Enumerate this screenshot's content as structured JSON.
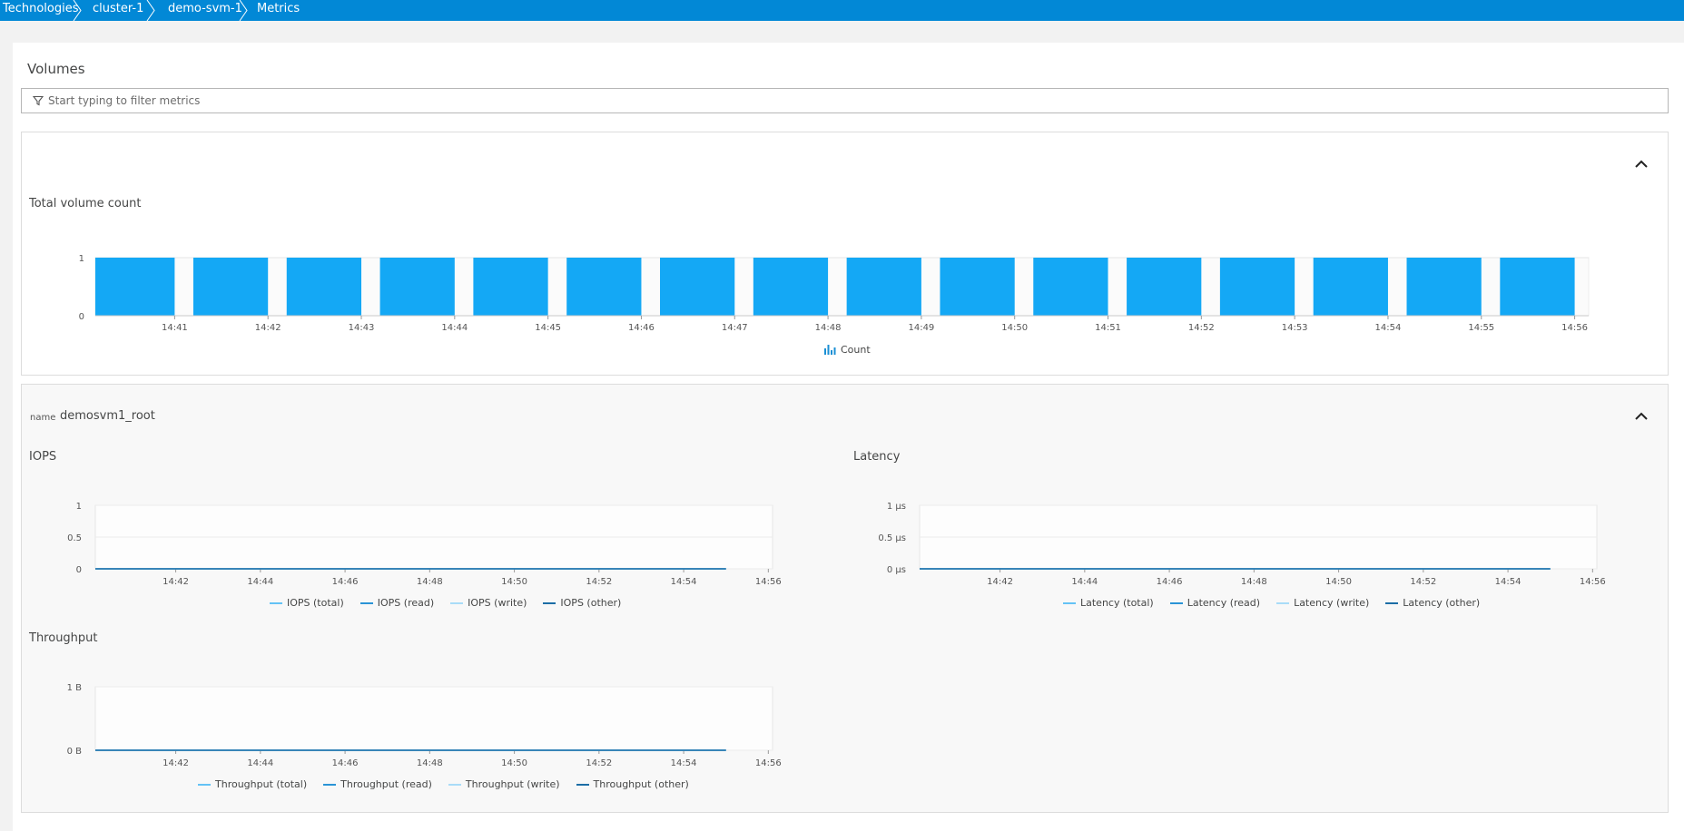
{
  "breadcrumb": [
    {
      "label": "Technologies"
    },
    {
      "label": "cluster-1"
    },
    {
      "label": "demo-svm-1"
    },
    {
      "label": "Metrics"
    }
  ],
  "section_title": "Volumes",
  "filter": {
    "placeholder": "Start typing to filter metrics"
  },
  "colors": {
    "accent": "#0288d6",
    "bar": "#14a8f5"
  },
  "volume_card": {
    "title": "Total volume count",
    "legend": "Count"
  },
  "detail_card": {
    "name_key": "name",
    "name_value": "demosvm1_root",
    "iops": {
      "title": "IOPS",
      "legend": [
        "IOPS (total)",
        "IOPS (read)",
        "IOPS (write)",
        "IOPS (other)"
      ]
    },
    "latency": {
      "title": "Latency",
      "legend": [
        "Latency (total)",
        "Latency (read)",
        "Latency (write)",
        "Latency (other)"
      ]
    },
    "throughput": {
      "title": "Throughput",
      "legend": [
        "Throughput (total)",
        "Throughput (read)",
        "Throughput (write)",
        "Throughput (other)"
      ]
    }
  },
  "chart_data": [
    {
      "type": "bar",
      "title": "Total volume count",
      "x": [
        "14:40",
        "14:41",
        "14:42",
        "14:43",
        "14:44",
        "14:45",
        "14:46",
        "14:47",
        "14:48",
        "14:49",
        "14:50",
        "14:51",
        "14:52",
        "14:53",
        "14:54",
        "14:55"
      ],
      "x_ticks": [
        "14:41",
        "14:42",
        "14:43",
        "14:44",
        "14:45",
        "14:46",
        "14:47",
        "14:48",
        "14:49",
        "14:50",
        "14:51",
        "14:52",
        "14:53",
        "14:54",
        "14:55",
        "14:56"
      ],
      "y_ticks": [
        "0",
        "1"
      ],
      "series": [
        {
          "name": "Count",
          "values": [
            1,
            1,
            1,
            1,
            1,
            1,
            1,
            1,
            1,
            1,
            1,
            1,
            1,
            1,
            1,
            1
          ]
        }
      ],
      "ylim": [
        0,
        1
      ],
      "legend": "bottom-center"
    },
    {
      "type": "line",
      "title": "IOPS",
      "x_ticks": [
        "14:42",
        "14:44",
        "14:46",
        "14:48",
        "14:50",
        "14:52",
        "14:54",
        "14:56"
      ],
      "y_ticks": [
        "0",
        "0.5",
        "1"
      ],
      "series": [
        {
          "name": "IOPS (total)",
          "values": [
            0,
            0
          ]
        },
        {
          "name": "IOPS (read)",
          "values": [
            0,
            0
          ]
        },
        {
          "name": "IOPS (write)",
          "values": [
            0,
            0
          ]
        },
        {
          "name": "IOPS (other)",
          "values": [
            0,
            0
          ]
        }
      ],
      "x": [
        "14:40",
        "14:55"
      ],
      "ylim": [
        0,
        1
      ]
    },
    {
      "type": "line",
      "title": "Latency",
      "x_ticks": [
        "14:42",
        "14:44",
        "14:46",
        "14:48",
        "14:50",
        "14:52",
        "14:54",
        "14:56"
      ],
      "y_ticks": [
        "0 µs",
        "0.5 µs",
        "1 µs"
      ],
      "series": [
        {
          "name": "Latency (total)",
          "values": [
            0,
            0
          ]
        },
        {
          "name": "Latency (read)",
          "values": [
            0,
            0
          ]
        },
        {
          "name": "Latency (write)",
          "values": [
            0,
            0
          ]
        },
        {
          "name": "Latency (other)",
          "values": [
            0,
            0
          ]
        }
      ],
      "x": [
        "14:40",
        "14:55"
      ],
      "ylim": [
        0,
        1
      ]
    },
    {
      "type": "line",
      "title": "Throughput",
      "x_ticks": [
        "14:42",
        "14:44",
        "14:46",
        "14:48",
        "14:50",
        "14:52",
        "14:54",
        "14:56"
      ],
      "y_ticks": [
        "0 B",
        "1 B"
      ],
      "series": [
        {
          "name": "Throughput (total)",
          "values": [
            0,
            0
          ]
        },
        {
          "name": "Throughput (read)",
          "values": [
            0,
            0
          ]
        },
        {
          "name": "Throughput (write)",
          "values": [
            0,
            0
          ]
        },
        {
          "name": "Throughput (other)",
          "values": [
            0,
            0
          ]
        }
      ],
      "x": [
        "14:40",
        "14:55"
      ],
      "ylim": [
        0,
        1
      ]
    }
  ]
}
